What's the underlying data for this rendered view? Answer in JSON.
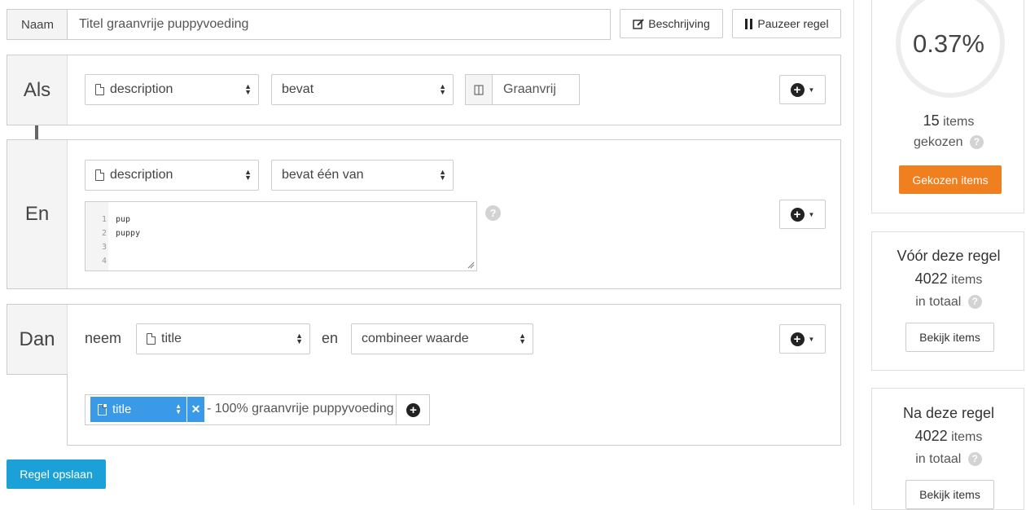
{
  "header": {
    "name_label": "Naam",
    "name_value": "Titel graanvrije puppyvoeding",
    "description_button": "Beschrijving",
    "pause_button": "Pauzeer regel"
  },
  "als": {
    "label": "Als",
    "field": "description",
    "operator": "bevat",
    "value": "Graanvrij"
  },
  "en": {
    "label": "En",
    "field": "description",
    "operator": "bevat één van",
    "lines": [
      {
        "num": "1",
        "text": "pup"
      },
      {
        "num": "2",
        "text": "puppy"
      },
      {
        "num": "3",
        "text": ""
      },
      {
        "num": "4",
        "text": ""
      }
    ]
  },
  "dan": {
    "label": "Dan",
    "neem": "neem",
    "field": "title",
    "en_word": "en",
    "action": "combineer waarde",
    "combine_field": "title",
    "combine_suffix": "- 100% graanvrije puppyvoeding"
  },
  "save_button": "Regel opslaan",
  "stats": {
    "percentage": "0.37%",
    "percentage_fraction": 0.0037,
    "chosen_count": "15",
    "chosen_items_word": "items",
    "chosen_label": "gekozen",
    "chosen_button": "Gekozen items",
    "before_title": "Vóór deze regel",
    "before_count": "4022",
    "before_items_word": "items",
    "before_total": "in totaal",
    "before_button": "Bekijk items",
    "after_title": "Na deze regel",
    "after_count": "4022",
    "after_items_word": "items",
    "after_total": "in totaal",
    "after_button": "Bekijk items"
  },
  "colors": {
    "accent_orange": "#f07f1f",
    "accent_blue": "#1ba1d8",
    "tag_blue": "#3a9ae8"
  },
  "icons": [
    "edit-icon",
    "pause-icon",
    "document-icon",
    "columns-icon",
    "plus-circle-icon",
    "caret-down-icon",
    "updown-icon",
    "close-icon",
    "question-icon",
    "resize-handle-icon"
  ]
}
